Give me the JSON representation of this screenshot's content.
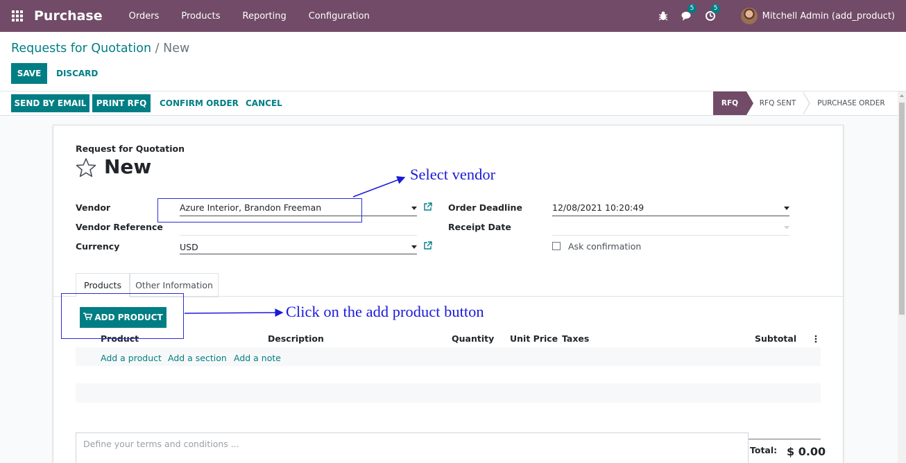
{
  "navbar": {
    "brand": "Purchase",
    "menu": [
      "Orders",
      "Products",
      "Reporting",
      "Configuration"
    ],
    "messages_count": "5",
    "activities_count": "5",
    "user": "Mitchell Admin (add_product)",
    "icons": [
      "apps-icon",
      "bug-icon",
      "chat-icon",
      "clock-icon"
    ]
  },
  "breadcrumb": {
    "parent": "Requests for Quotation",
    "separator": " / ",
    "current": "New"
  },
  "actions": {
    "save": "SAVE",
    "discard": "DISCARD"
  },
  "statusbar": {
    "buttons": [
      "SEND BY EMAIL",
      "PRINT RFQ",
      "CONFIRM ORDER",
      "CANCEL"
    ],
    "stages": [
      "RFQ",
      "RFQ SENT",
      "PURCHASE ORDER"
    ],
    "active_stage": "RFQ"
  },
  "form": {
    "doc_type": "Request for Quotation",
    "name": "New",
    "vendor_label": "Vendor",
    "vendor_value": "Azure Interior, Brandon Freeman",
    "vendor_ref_label": "Vendor Reference",
    "vendor_ref_value": "",
    "currency_label": "Currency",
    "currency_value": "USD",
    "order_deadline_label": "Order Deadline",
    "order_deadline_value": "12/08/2021 10:20:49",
    "receipt_date_label": "Receipt Date",
    "receipt_date_value": "",
    "ask_confirmation_label": "Ask confirmation",
    "ask_confirmation_checked": false
  },
  "tabs": [
    "Products",
    "Other Information"
  ],
  "lines": {
    "add_product_button": "ADD PRODUCT",
    "columns": [
      "Product",
      "Description",
      "Quantity",
      "Unit Price",
      "Taxes",
      "Subtotal"
    ],
    "add_links": [
      "Add a product",
      "Add a section",
      "Add a note"
    ]
  },
  "terms_placeholder": "Define your terms and conditions ...",
  "total": {
    "label": "Total:",
    "value": "$ 0.00"
  },
  "annotations": {
    "vendor_note": "Select vendor",
    "add_product_note": "Click on the add product button",
    "color": "#1a1ad9"
  },
  "colors": {
    "brand": "#714b67",
    "primary": "#017e84"
  }
}
